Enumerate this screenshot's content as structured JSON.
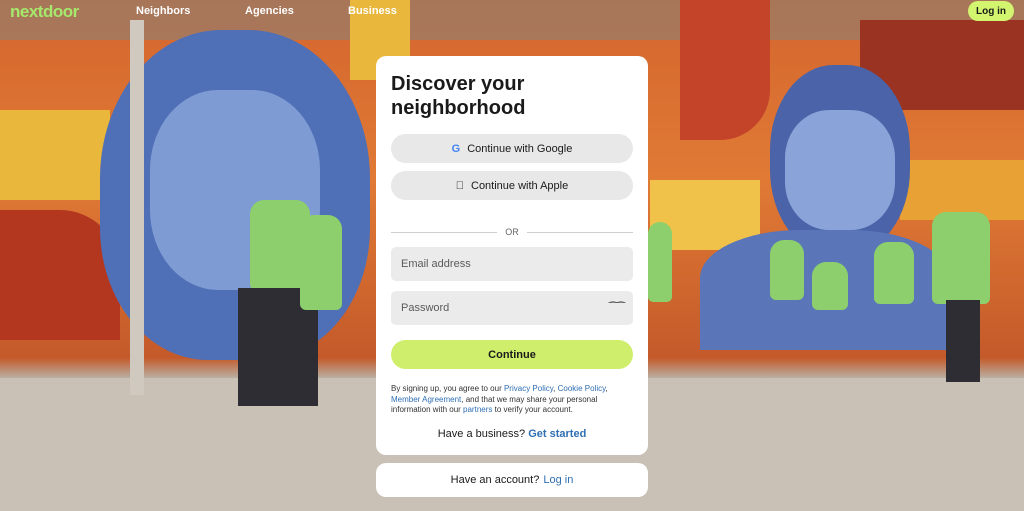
{
  "nav": {
    "logo": "nextdoor",
    "links": [
      "Neighbors",
      "Agencies",
      "Business"
    ],
    "login": "Log in"
  },
  "signup": {
    "title": "Discover your neighborhood",
    "google": "Continue with Google",
    "apple": "Continue with Apple",
    "divider": "OR",
    "email_placeholder": "Email address",
    "password_placeholder": "Password",
    "continue": "Continue",
    "legal": {
      "p1": "By signing up, you agree to our ",
      "privacy": "Privacy Policy",
      "comma": ", ",
      "cookie": "Cookie Policy",
      "comma2": ", ",
      "member": "Member Agreement",
      "p2": ", and that we may share your personal information with our ",
      "partners": "partners",
      "p3": " to verify your account."
    },
    "business_prompt": "Have a business?",
    "business_link": "Get started"
  },
  "account": {
    "prompt": "Have an account?",
    "link": "Log in"
  },
  "colors": {
    "brand_green": "#a6e86c",
    "cta_green": "#cfee6c",
    "link_blue": "#2f6fb3"
  },
  "icons": {
    "google": "google-icon",
    "apple": "apple-icon",
    "password_toggle": "eye-closed-icon"
  }
}
